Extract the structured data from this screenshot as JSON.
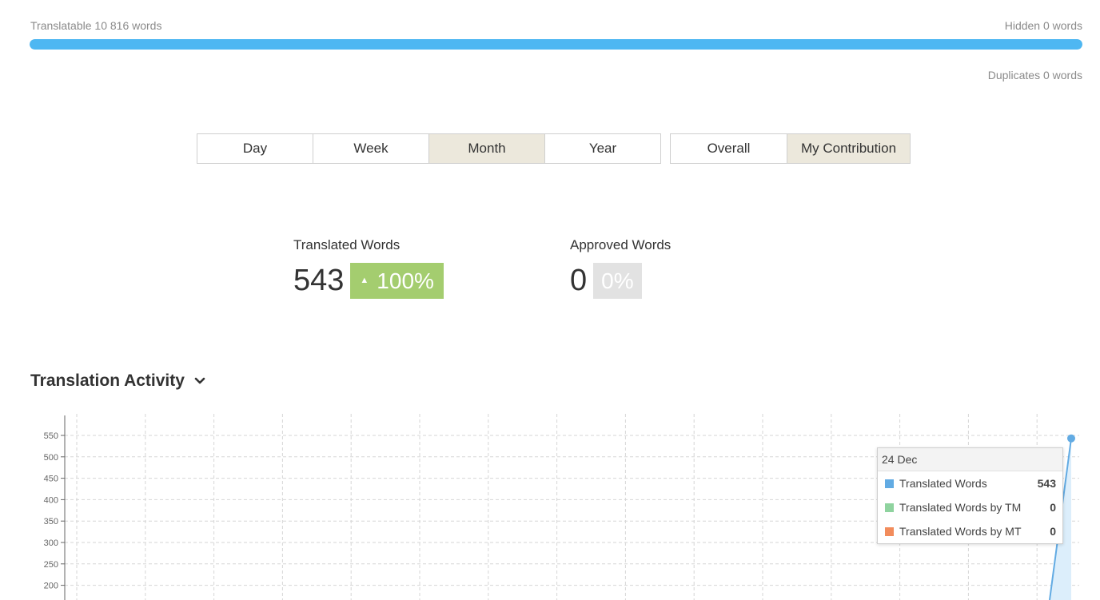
{
  "summary": {
    "translatable": "Translatable 10 816 words",
    "hidden": "Hidden 0 words",
    "duplicates": "Duplicates 0 words",
    "progress_fraction": 1.0,
    "progress_color": "#4eb7f2"
  },
  "period_buttons": [
    {
      "label": "Day",
      "active": false
    },
    {
      "label": "Week",
      "active": false
    },
    {
      "label": "Month",
      "active": true
    },
    {
      "label": "Year",
      "active": false
    }
  ],
  "scope_buttons": [
    {
      "label": "Overall",
      "active": false
    },
    {
      "label": "My Contribution",
      "active": true
    }
  ],
  "stats": {
    "translated": {
      "label": "Translated Words",
      "value": "543",
      "change": "100%",
      "trend_icon": "triangle-up-icon",
      "badge_color": "#a4cd6f"
    },
    "approved": {
      "label": "Approved Words",
      "value": "0",
      "change": "0%",
      "badge_color": "#e2e2e2"
    }
  },
  "section": {
    "title": "Translation Activity",
    "toggle_icon": "chevron-down-icon"
  },
  "chart_data": {
    "type": "area",
    "y_ticks": [
      "550",
      "500",
      "450",
      "400",
      "350",
      "300",
      "250",
      "200"
    ],
    "ylim": [
      200,
      550
    ],
    "series": [
      {
        "name": "Translated Words",
        "color": "#62abe3",
        "last_value": 543
      }
    ],
    "grid": true
  },
  "tooltip": {
    "date": "24 Dec",
    "rows": [
      {
        "name": "Translated Words",
        "value": "543",
        "color": "#62abe3"
      },
      {
        "name": "Translated Words by TM",
        "value": "0",
        "color": "#8fd39f"
      },
      {
        "name": "Translated Words by MT",
        "value": "0",
        "color": "#f28c5c"
      }
    ]
  }
}
